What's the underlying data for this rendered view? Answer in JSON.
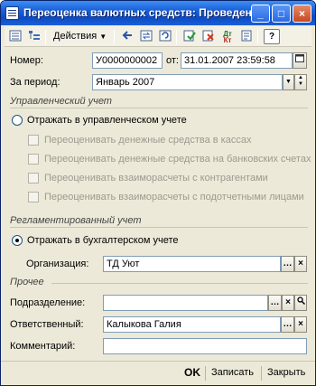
{
  "window": {
    "title": "Переоценка валютных средств: Проведен",
    "controls": {
      "minimize": "_",
      "maximize": "□",
      "close": "×"
    }
  },
  "toolbar": {
    "actions_label": "Действия",
    "icons": [
      "list-icon",
      "tree-icon",
      "arrow-left-icon",
      "swap-icon",
      "refresh-icon",
      "post-icon",
      "unpost-icon",
      "dt-kt-icon",
      "report-icon",
      "help-icon"
    ],
    "dtkt_label": "Дт\nКт",
    "help_label": "?"
  },
  "header": {
    "number_label": "Номер:",
    "number_value": "У0000000002",
    "from_label": "от:",
    "date_value": "31.01.2007 23:59:58",
    "period_label": "За период:",
    "period_value": "Январь 2007"
  },
  "management": {
    "title": "Управленческий учет",
    "reflect_label": "Отражать в управленческом учете",
    "reflect_checked": false,
    "options": [
      "Переоценивать денежные средства в кассах",
      "Переоценивать денежные средства на банковских счетах",
      "Переоценивать взаиморасчеты с контрагентами",
      "Переоценивать взаиморасчеты с подотчетными лицами"
    ]
  },
  "regulated": {
    "title": "Регламентированный учет",
    "reflect_label": "Отражать в бухгалтерском учете",
    "reflect_checked": true,
    "org_label": "Организация:",
    "org_value": "ТД Уют"
  },
  "other": {
    "title": "Прочее",
    "dept_label": "Подразделение:",
    "dept_value": "",
    "resp_label": "Ответственный:",
    "resp_value": "Калыкова Галия",
    "comment_label": "Комментарий:",
    "comment_value": ""
  },
  "footer": {
    "ok_label": "OK",
    "save_label": "Записать",
    "close_label": "Закрыть"
  }
}
